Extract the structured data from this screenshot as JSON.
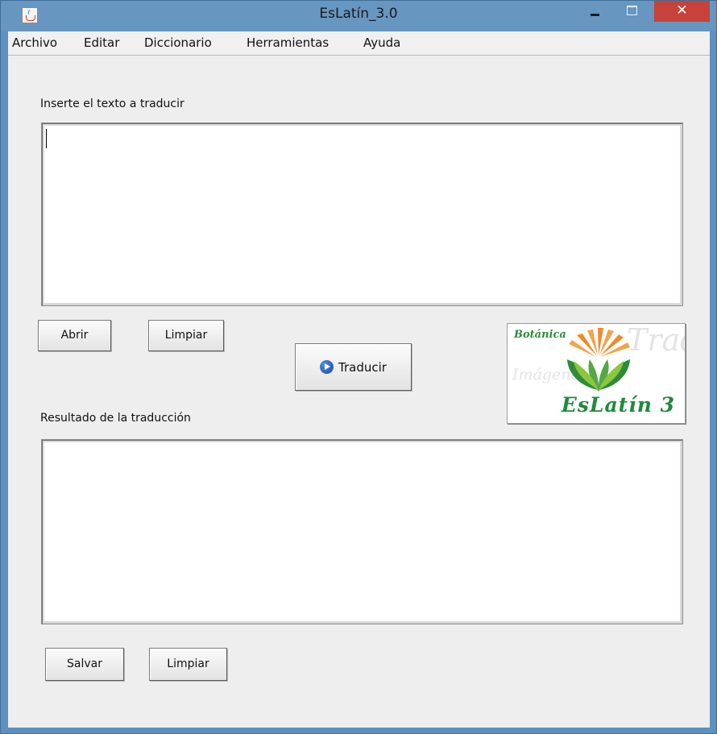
{
  "window": {
    "title": "EsLatín_3.0",
    "close_glyph": "✕"
  },
  "menu": {
    "items": [
      "Archivo",
      "Editar",
      "Diccionario",
      "Herramientas",
      "Ayuda"
    ]
  },
  "input_section": {
    "label": "Inserte el texto a traducir",
    "value": ""
  },
  "input_buttons": {
    "open": "Abrir",
    "clear": "Limpiar"
  },
  "translate_button": {
    "label": "Traducir",
    "icon": "play-circle-icon"
  },
  "logo": {
    "top_text": "Botánica",
    "title": "EsLatín 3",
    "colors": {
      "green": "#1f8a3c",
      "orange": "#f08a2c"
    }
  },
  "output_section": {
    "label": "Resultado de la traducción",
    "value": ""
  },
  "output_buttons": {
    "save": "Salvar",
    "clear": "Limpiar"
  },
  "colors": {
    "title_bar": "#6796c1",
    "close_button": "#c7423a",
    "panel": "#eeeeee"
  }
}
